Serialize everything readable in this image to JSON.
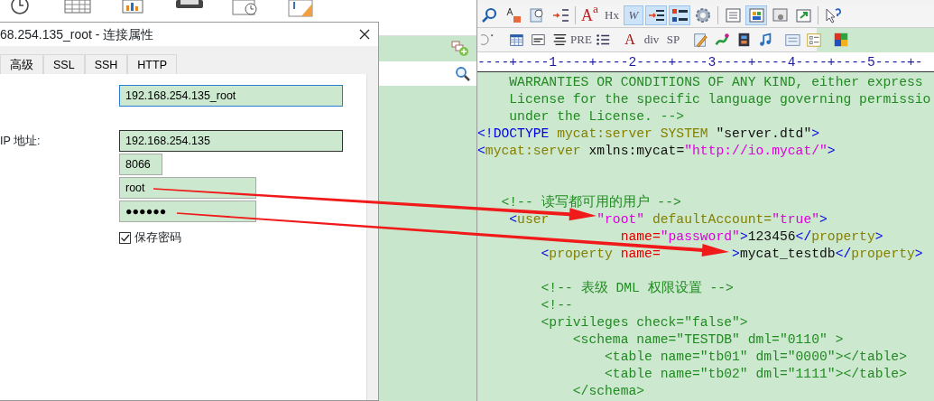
{
  "dialog": {
    "title": "68.254.135_root - 连接属性",
    "tabs": [
      {
        "label": "高级",
        "selected": false
      },
      {
        "label": "SSL",
        "selected": false
      },
      {
        "label": "SSH",
        "selected": false
      },
      {
        "label": "HTTP",
        "selected": false
      }
    ],
    "fields": [
      {
        "kind": "name",
        "value": "192.168.254.135_root",
        "focused": true
      },
      {
        "kind": "host",
        "label": "IP 地址:",
        "value": "192.168.254.135",
        "focused": false
      },
      {
        "kind": "port",
        "value": "8066",
        "focused": false
      },
      {
        "kind": "user",
        "value": "root",
        "focused": false
      },
      {
        "kind": "password",
        "value": "●●●●●●",
        "focused": false
      }
    ],
    "save_password": {
      "label": "保存密码",
      "checked": true
    }
  },
  "editor": {
    "toolbar_rows": [
      [
        {
          "kind": "icon",
          "pressed": false
        },
        {
          "kind": "icon",
          "pressed": false
        },
        {
          "kind": "icon",
          "pressed": false
        },
        {
          "kind": "icon",
          "pressed": false
        },
        {
          "kind": "separator"
        },
        {
          "kind": "label",
          "label": "A$^{a}$",
          "pressed": false
        },
        {
          "kind": "label",
          "label": "Hx",
          "pressed": false
        },
        {
          "kind": "label",
          "label": "W",
          "pressed": true
        },
        {
          "kind": "icon",
          "pressed": true
        },
        {
          "kind": "icon",
          "pressed": true
        },
        {
          "kind": "icon",
          "pressed": false
        },
        {
          "kind": "separator"
        },
        {
          "kind": "icon",
          "pressed": false
        },
        {
          "kind": "icon",
          "pressed": true
        },
        {
          "kind": "icon",
          "pressed": false
        },
        {
          "kind": "icon",
          "pressed": false
        },
        {
          "kind": "separator"
        },
        {
          "kind": "icon",
          "pressed": false
        }
      ],
      [
        {
          "kind": "icon",
          "pressed": false
        },
        {
          "kind": "separator"
        },
        {
          "kind": "icon",
          "pressed": false
        },
        {
          "kind": "icon",
          "pressed": false
        },
        {
          "kind": "icon",
          "pressed": false
        },
        {
          "kind": "label",
          "label": "PRE",
          "pressed": false
        },
        {
          "kind": "icon",
          "pressed": false
        },
        {
          "kind": "separator"
        },
        {
          "kind": "label",
          "label": "A",
          "pressed": false
        },
        {
          "kind": "label",
          "label": "div",
          "pressed": false
        },
        {
          "kind": "label",
          "label": "SP",
          "pressed": false
        },
        {
          "kind": "separator"
        },
        {
          "kind": "icon",
          "pressed": false
        },
        {
          "kind": "icon",
          "pressed": false
        },
        {
          "kind": "icon",
          "pressed": false
        },
        {
          "kind": "icon",
          "pressed": false
        },
        {
          "kind": "separator"
        },
        {
          "kind": "icon",
          "pressed": false
        },
        {
          "kind": "icon",
          "pressed": false
        },
        {
          "kind": "separator"
        },
        {
          "kind": "icon",
          "pressed": false
        }
      ]
    ],
    "ruler": "----+----1----+----2----+----3----+----4----+----5----+-",
    "lines": [
      {
        "kind": "code",
        "segments": [
          {
            "kind": "comment",
            "text": "    WARRANTIES OR CONDITIONS OF ANY KIND, either express"
          }
        ]
      },
      {
        "kind": "code",
        "segments": [
          {
            "kind": "comment",
            "text": "    License for the specific language governing permissio"
          }
        ]
      },
      {
        "kind": "code",
        "segments": [
          {
            "kind": "comment",
            "text": "    under the License. -->"
          }
        ]
      },
      {
        "kind": "code",
        "segments": [
          {
            "kind": "punct",
            "text": "<!DOCTYPE"
          },
          {
            "kind": "tag",
            "text": " mycat:server SYSTEM "
          },
          {
            "kind": "text",
            "text": "\"server.dtd\""
          },
          {
            "kind": "punct",
            "text": ">"
          }
        ]
      },
      {
        "kind": "code",
        "segments": [
          {
            "kind": "punct",
            "text": "<"
          },
          {
            "kind": "tag",
            "text": "mycat:server"
          },
          {
            "kind": "text",
            "text": " xmlns:mycat="
          },
          {
            "kind": "value",
            "text": "\"http://io.mycat/\""
          },
          {
            "kind": "punct",
            "text": ">"
          }
        ]
      },
      {
        "kind": "blank"
      },
      {
        "kind": "blank"
      },
      {
        "kind": "code",
        "segments": [
          {
            "kind": "comment",
            "text": "   <!-- 读写都可用的用户 -->"
          }
        ]
      },
      {
        "kind": "code",
        "segments": [
          {
            "kind": "punct",
            "text": "    <"
          },
          {
            "kind": "tag",
            "text": "user      "
          },
          {
            "kind": "value",
            "text": "\"root\""
          },
          {
            "kind": "tag",
            "text": " defaultAccount="
          },
          {
            "kind": "value",
            "text": "\"true\""
          },
          {
            "kind": "punct",
            "text": ">"
          }
        ]
      },
      {
        "kind": "code",
        "segments": [
          {
            "kind": "attr",
            "text": "                  name="
          },
          {
            "kind": "value",
            "text": "\"password\""
          },
          {
            "kind": "punct",
            "text": ">"
          },
          {
            "kind": "text",
            "text": "123456"
          },
          {
            "kind": "punct",
            "text": "</"
          },
          {
            "kind": "tag",
            "text": "property"
          },
          {
            "kind": "punct",
            "text": ">"
          }
        ]
      },
      {
        "kind": "code",
        "segments": [
          {
            "kind": "punct",
            "text": "        <"
          },
          {
            "kind": "tag",
            "text": "property"
          },
          {
            "kind": "attr",
            "text": " name=         "
          },
          {
            "kind": "punct",
            "text": ">"
          },
          {
            "kind": "text",
            "text": "mycat_testdb"
          },
          {
            "kind": "punct",
            "text": "</"
          },
          {
            "kind": "tag",
            "text": "property"
          },
          {
            "kind": "punct",
            "text": ">"
          }
        ]
      },
      {
        "kind": "blank"
      },
      {
        "kind": "code",
        "segments": [
          {
            "kind": "comment",
            "text": "        <!-- 表级 DML 权限设置 -->"
          }
        ]
      },
      {
        "kind": "code",
        "segments": [
          {
            "kind": "comment",
            "text": "        <!--"
          }
        ]
      },
      {
        "kind": "code",
        "segments": [
          {
            "kind": "comment",
            "text": "        <privileges check=\"false\">"
          }
        ]
      },
      {
        "kind": "code",
        "segments": [
          {
            "kind": "comment",
            "text": "            <schema name=\"TESTDB\" dml=\"0110\" >"
          }
        ]
      },
      {
        "kind": "code",
        "segments": [
          {
            "kind": "comment",
            "text": "                <table name=\"tb01\" dml=\"0000\"></table>"
          }
        ]
      },
      {
        "kind": "code",
        "segments": [
          {
            "kind": "comment",
            "text": "                <table name=\"tb02\" dml=\"1111\"></table>"
          }
        ]
      },
      {
        "kind": "code",
        "segments": [
          {
            "kind": "comment",
            "text": "            </schema>"
          }
        ]
      }
    ]
  }
}
